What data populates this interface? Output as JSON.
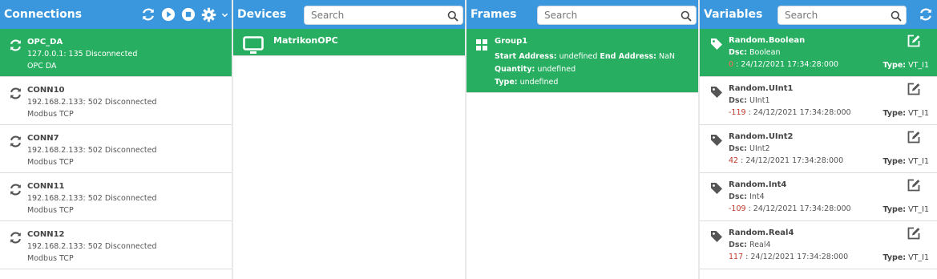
{
  "colors": {
    "header": "#3a97dd",
    "selected": "#27ae60",
    "value": "#c0392b"
  },
  "connections": {
    "title": "Connections",
    "tools": [
      "refresh-icon",
      "play-icon",
      "stop-icon",
      "gear-icon",
      "chevron-down-icon"
    ],
    "items": [
      {
        "name": "OPC_DA",
        "address": "127.0.0.1: 135 Disconnected",
        "protocol": "OPC DA"
      },
      {
        "name": "CONN10",
        "address": "192.168.2.133: 502 Disconnected",
        "protocol": "Modbus TCP"
      },
      {
        "name": "CONN7",
        "address": "192.168.2.133: 502 Disconnected",
        "protocol": "Modbus TCP"
      },
      {
        "name": "CONN11",
        "address": "192.168.2.133: 502 Disconnected",
        "protocol": "Modbus TCP"
      },
      {
        "name": "CONN12",
        "address": "192.168.2.133: 502 Disconnected",
        "protocol": "Modbus TCP"
      }
    ]
  },
  "devices": {
    "title": "Devices",
    "search_placeholder": "Search",
    "items": [
      {
        "name": "MatrikonOPC"
      }
    ]
  },
  "frames": {
    "title": "Frames",
    "search_placeholder": "Search",
    "items": [
      {
        "name": "Group1",
        "start_label": "Start Address:",
        "start_value": "undefined",
        "end_label": "End Address:",
        "end_value": "NaN",
        "qty_label": "Quantity:",
        "qty_value": "undefined",
        "type_label": "Type:",
        "type_value": "undefined"
      }
    ]
  },
  "variables": {
    "title": "Variables",
    "search_placeholder": "Search",
    "dsc_label": "Dsc:",
    "type_label": "Type:",
    "items": [
      {
        "name": "Random.Boolean",
        "dsc": "Boolean",
        "value": "0",
        "timestamp": " : 24/12/2021 17:34:28:000",
        "type": "VT_I1"
      },
      {
        "name": "Random.UInt1",
        "dsc": "UInt1",
        "value": "-119",
        "timestamp": " : 24/12/2021 17:34:28:000",
        "type": "VT_I1"
      },
      {
        "name": "Random.UInt2",
        "dsc": "UInt2",
        "value": "42",
        "timestamp": " : 24/12/2021 17:34:28:000",
        "type": "VT_I1"
      },
      {
        "name": "Random.Int4",
        "dsc": "Int4",
        "value": "-109",
        "timestamp": " : 24/12/2021 17:34:28:000",
        "type": "VT_I1"
      },
      {
        "name": "Random.Real4",
        "dsc": "Real4",
        "value": "117",
        "timestamp": " : 24/12/2021 17:34:28:000",
        "type": "VT_I1"
      }
    ]
  }
}
